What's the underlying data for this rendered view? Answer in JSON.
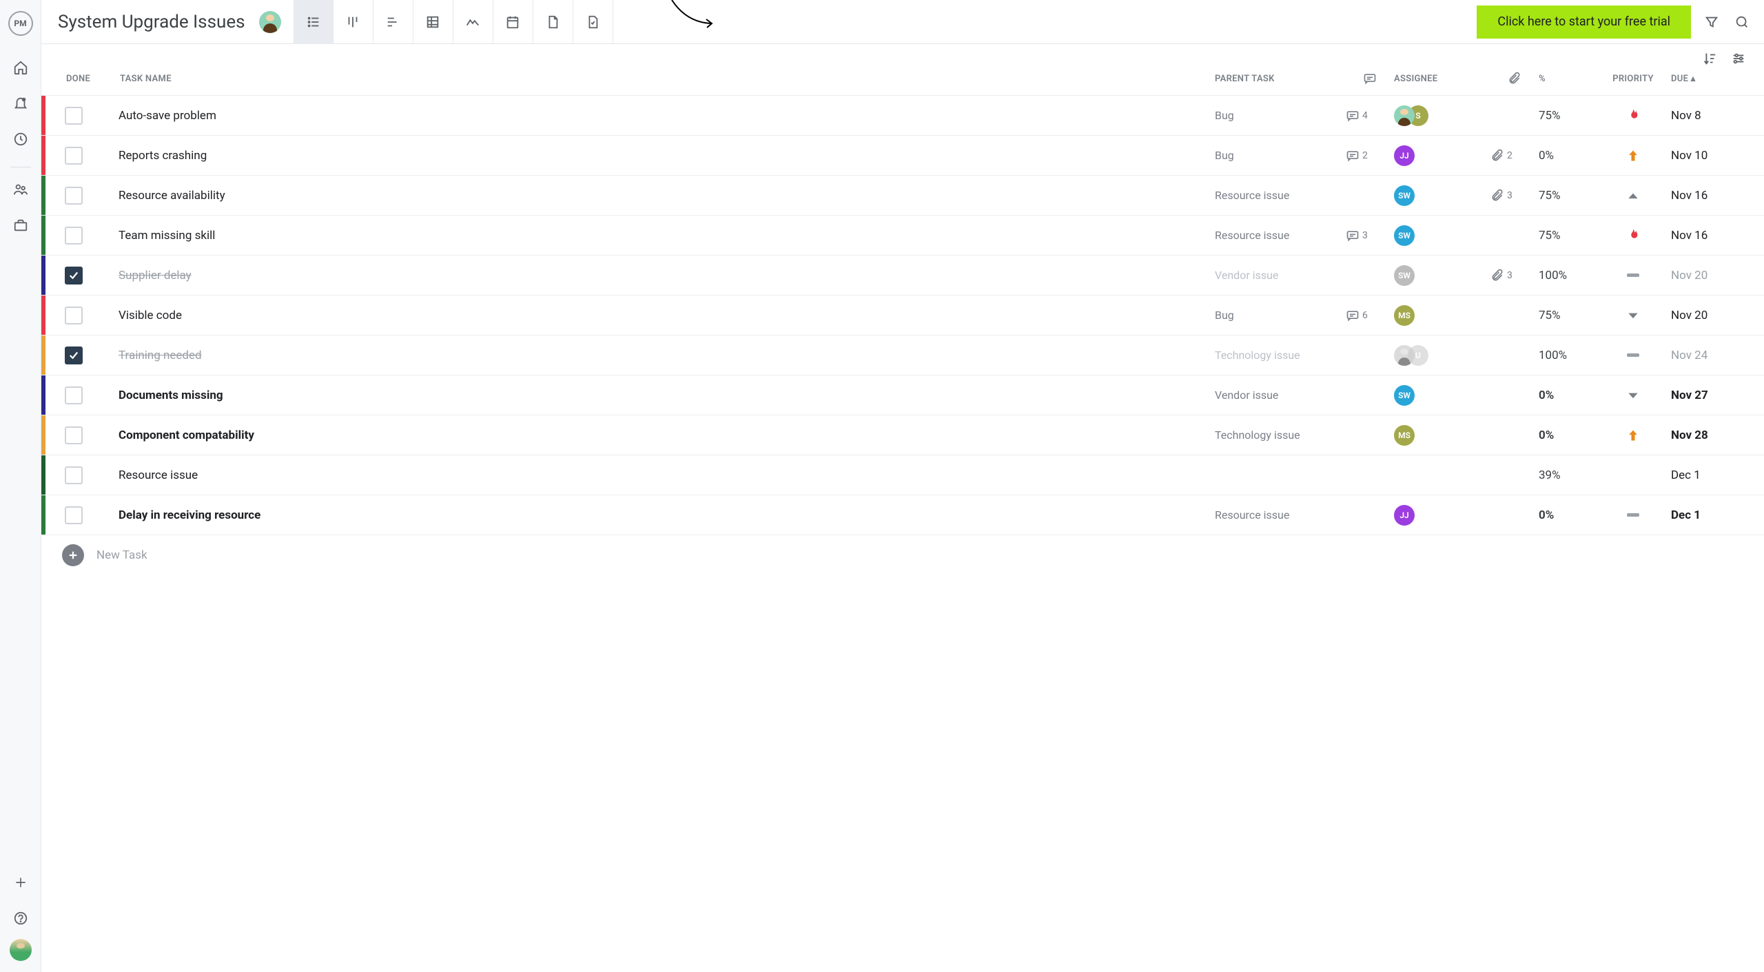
{
  "app": {
    "logo_text": "PM"
  },
  "page": {
    "title": "System Upgrade Issues"
  },
  "cta": {
    "label": "Click here to start your free trial"
  },
  "columns": {
    "done": "DONE",
    "name": "TASK NAME",
    "parent": "PARENT TASK",
    "assignee": "ASSIGNEE",
    "percent": "%",
    "priority": "PRIORITY",
    "due": "DUE ▴"
  },
  "new_task": {
    "label": "New Task"
  },
  "colors": {
    "bug": "#e63946",
    "resource": "#2a7a3a",
    "vendor": "#2a2a8a",
    "technology": "#e8a23a",
    "group": "#1e5e2e"
  },
  "avatar_colors": {
    "S": "#a3a84a",
    "JJ": "#9b3de0",
    "SW": "#2aa5d8",
    "MS": "#a3a84a",
    "U": "#c8ccd0"
  },
  "tasks": [
    {
      "done": false,
      "name": "Auto-save problem",
      "parent": "Bug",
      "color": "bug",
      "comments": 4,
      "attachments": null,
      "assignees": [
        {
          "type": "photo"
        },
        {
          "type": "initials",
          "text": "S",
          "key": "S"
        }
      ],
      "percent": "75%",
      "priority": "flame",
      "due": "Nov 8",
      "bold": false
    },
    {
      "done": false,
      "name": "Reports crashing",
      "parent": "Bug",
      "color": "bug",
      "comments": 2,
      "attachments": 2,
      "assignees": [
        {
          "type": "initials",
          "text": "JJ",
          "key": "JJ"
        }
      ],
      "percent": "0%",
      "priority": "up-arrow",
      "due": "Nov 10",
      "bold": false
    },
    {
      "done": false,
      "name": "Resource availability",
      "parent": "Resource issue",
      "color": "resource",
      "comments": null,
      "attachments": 3,
      "assignees": [
        {
          "type": "initials",
          "text": "SW",
          "key": "SW"
        }
      ],
      "percent": "75%",
      "priority": "triangle-up",
      "due": "Nov 16",
      "bold": false
    },
    {
      "done": false,
      "name": "Team missing skill",
      "parent": "Resource issue",
      "color": "resource",
      "comments": 3,
      "attachments": null,
      "assignees": [
        {
          "type": "initials",
          "text": "SW",
          "key": "SW"
        }
      ],
      "percent": "75%",
      "priority": "flame",
      "due": "Nov 16",
      "bold": false
    },
    {
      "done": true,
      "name": "Supplier delay",
      "parent": "Vendor issue",
      "color": "vendor",
      "comments": null,
      "attachments": 3,
      "assignees": [
        {
          "type": "initials",
          "text": "SW",
          "key": "SW"
        }
      ],
      "percent": "100%",
      "priority": "dash",
      "due": "Nov 20",
      "bold": false
    },
    {
      "done": false,
      "name": "Visible code",
      "parent": "Bug",
      "color": "bug",
      "comments": 6,
      "attachments": null,
      "assignees": [
        {
          "type": "initials",
          "text": "MS",
          "key": "MS"
        }
      ],
      "percent": "75%",
      "priority": "triangle-down",
      "due": "Nov 20",
      "bold": false
    },
    {
      "done": true,
      "name": "Training needed",
      "parent": "Technology issue",
      "color": "technology",
      "comments": null,
      "attachments": null,
      "assignees": [
        {
          "type": "photo"
        },
        {
          "type": "initials",
          "text": "U",
          "key": "U"
        }
      ],
      "percent": "100%",
      "priority": "dash",
      "due": "Nov 24",
      "bold": false
    },
    {
      "done": false,
      "name": "Documents missing",
      "parent": "Vendor issue",
      "color": "vendor",
      "comments": null,
      "attachments": null,
      "assignees": [
        {
          "type": "initials",
          "text": "SW",
          "key": "SW"
        }
      ],
      "percent": "0%",
      "priority": "triangle-down",
      "due": "Nov 27",
      "bold": true
    },
    {
      "done": false,
      "name": "Component compatability",
      "parent": "Technology issue",
      "color": "technology",
      "comments": null,
      "attachments": null,
      "assignees": [
        {
          "type": "initials",
          "text": "MS",
          "key": "MS"
        }
      ],
      "percent": "0%",
      "priority": "up-arrow",
      "due": "Nov 28",
      "bold": true
    },
    {
      "done": false,
      "name": "Resource issue",
      "parent": "",
      "color": "group",
      "comments": null,
      "attachments": null,
      "assignees": [],
      "percent": "39%",
      "priority": "",
      "due": "Dec 1",
      "bold": false
    },
    {
      "done": false,
      "name": "Delay in receiving resource",
      "parent": "Resource issue",
      "color": "resource",
      "comments": null,
      "attachments": null,
      "assignees": [
        {
          "type": "initials",
          "text": "JJ",
          "key": "JJ"
        }
      ],
      "percent": "0%",
      "priority": "dash",
      "due": "Dec 1",
      "bold": true
    }
  ]
}
